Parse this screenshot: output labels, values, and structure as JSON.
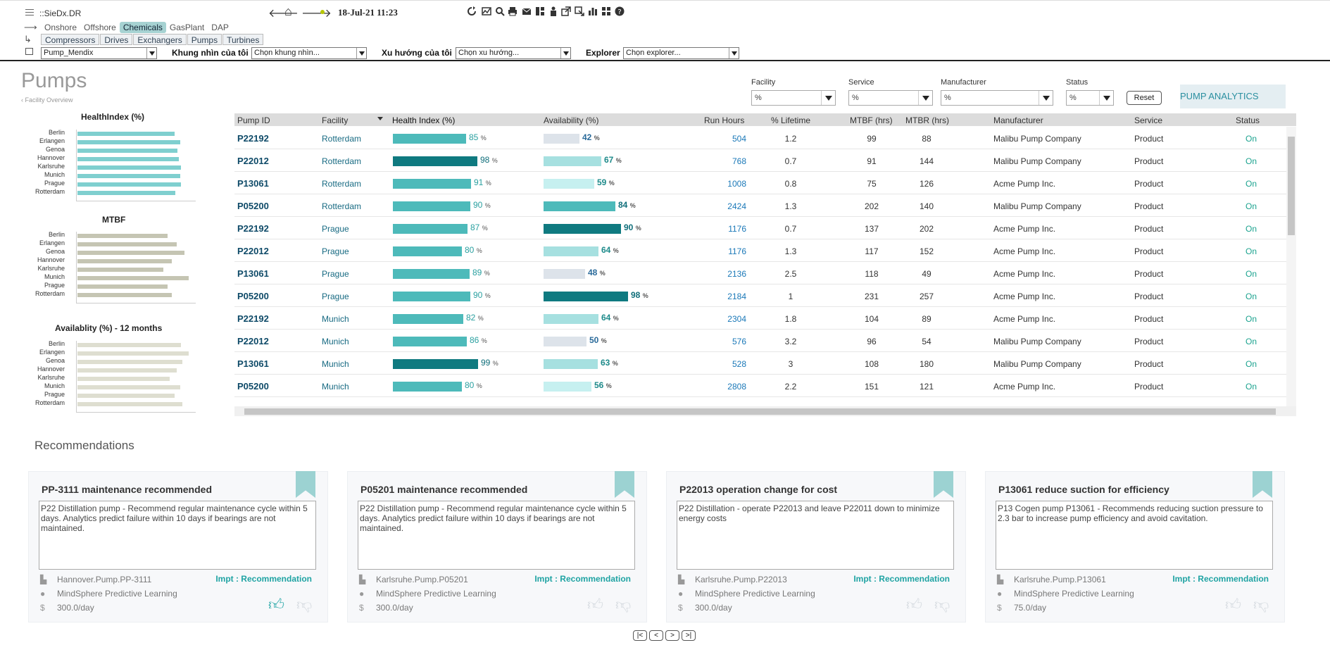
{
  "header": {
    "app_name": "::SieDx.DR",
    "datetime": "18-Jul-21 11:23",
    "nav_row1": [
      "Onshore",
      "Offshore",
      "Chemicals",
      "GasPlant",
      "DAP"
    ],
    "nav_row1_active": "Chemicals",
    "nav_row2": [
      "Compressors",
      "Drives",
      "Exchangers",
      "Pumps",
      "Turbines"
    ],
    "selectors": {
      "view_value": "Pump_Mendix",
      "khung_label": "Khung nhìn của tôi",
      "khung_value": "Chọn khung nhìn...",
      "xu_label": "Xu hướng của tôi",
      "xu_value": "Chọn xu hướng...",
      "explorer_label": "Explorer",
      "explorer_value": "Chọn explorer..."
    }
  },
  "page": {
    "title": "Pumps",
    "breadcrumb": "‹  Facility Overview",
    "analytics_label": "PUMP ANALYTICS",
    "reset_label": "Reset"
  },
  "filters": [
    {
      "label": "Facility",
      "value": "%"
    },
    {
      "label": "Service",
      "value": "%"
    },
    {
      "label": "Manufacturer",
      "value": "%"
    },
    {
      "label": "Status",
      "value": "%"
    }
  ],
  "mini_charts": {
    "cities": [
      "Berlin",
      "Erlangen",
      "Genoa",
      "Hannover",
      "Karlsruhe",
      "Munich",
      "Prague",
      "Rotterdam"
    ],
    "health": {
      "title": "HealthIndex (%)",
      "values": [
        0.86,
        0.91,
        0.89,
        0.9,
        0.92,
        0.91,
        0.92,
        0.87
      ],
      "color": "#7fcfcf"
    },
    "mtbf": {
      "title": "MTBF",
      "values": [
        0.8,
        0.88,
        0.95,
        0.84,
        0.76,
        0.99,
        0.8,
        0.84
      ],
      "color": "#c5c5b3"
    },
    "availability": {
      "title": "Availablity (%) - 12 months",
      "values": [
        0.92,
        0.99,
        0.93,
        0.88,
        0.82,
        0.91,
        0.86,
        0.93
      ],
      "color": "#deded0"
    }
  },
  "table": {
    "headers": [
      "Pump ID",
      "Facility",
      "Health Index (%)",
      "Availability (%)",
      "Run Hours",
      "% Lifetime",
      "MTBF (hrs)",
      "MTBR (hrs)",
      "Manufacturer",
      "Service",
      "Status"
    ],
    "rows": [
      {
        "id": "P22192",
        "facility": "Rotterdam",
        "health": 85,
        "avail": 42,
        "run": "504",
        "life": "1.2",
        "mtbf": "99",
        "mtbr": "88",
        "mfr": "Malibu Pump Company",
        "service": "Product",
        "status": "On"
      },
      {
        "id": "P22012",
        "facility": "Rotterdam",
        "health": 98,
        "avail": 67,
        "run": "768",
        "life": "0.7",
        "mtbf": "91",
        "mtbr": "144",
        "mfr": "Malibu Pump Company",
        "service": "Product",
        "status": "On"
      },
      {
        "id": "P13061",
        "facility": "Rotterdam",
        "health": 91,
        "avail": 59,
        "run": "1008",
        "life": "0.8",
        "mtbf": "75",
        "mtbr": "126",
        "mfr": "Acme Pump Inc.",
        "service": "Product",
        "status": "On"
      },
      {
        "id": "P05200",
        "facility": "Rotterdam",
        "health": 90,
        "avail": 84,
        "run": "2424",
        "life": "1.3",
        "mtbf": "202",
        "mtbr": "140",
        "mfr": "Malibu Pump Company",
        "service": "Product",
        "status": "On"
      },
      {
        "id": "P22192",
        "facility": "Prague",
        "health": 87,
        "avail": 90,
        "run": "1176",
        "life": "0.7",
        "mtbf": "137",
        "mtbr": "202",
        "mfr": "Acme Pump Inc.",
        "service": "Product",
        "status": "On"
      },
      {
        "id": "P22012",
        "facility": "Prague",
        "health": 80,
        "avail": 64,
        "run": "1176",
        "life": "1.3",
        "mtbf": "117",
        "mtbr": "152",
        "mfr": "Acme Pump Inc.",
        "service": "Product",
        "status": "On"
      },
      {
        "id": "P13061",
        "facility": "Prague",
        "health": 89,
        "avail": 48,
        "run": "2136",
        "life": "2.5",
        "mtbf": "118",
        "mtbr": "49",
        "mfr": "Acme Pump Inc.",
        "service": "Product",
        "status": "On"
      },
      {
        "id": "P05200",
        "facility": "Prague",
        "health": 90,
        "avail": 98,
        "run": "2184",
        "life": "1",
        "mtbf": "231",
        "mtbr": "257",
        "mfr": "Acme Pump Inc.",
        "service": "Product",
        "status": "On"
      },
      {
        "id": "P22192",
        "facility": "Munich",
        "health": 82,
        "avail": 64,
        "run": "2304",
        "life": "1.8",
        "mtbf": "104",
        "mtbr": "89",
        "mfr": "Acme Pump Inc.",
        "service": "Product",
        "status": "On"
      },
      {
        "id": "P22012",
        "facility": "Munich",
        "health": 86,
        "avail": 50,
        "run": "576",
        "life": "3.2",
        "mtbf": "96",
        "mtbr": "54",
        "mfr": "Malibu Pump Company",
        "service": "Product",
        "status": "On"
      },
      {
        "id": "P13061",
        "facility": "Munich",
        "health": 99,
        "avail": 63,
        "run": "528",
        "life": "3",
        "mtbf": "108",
        "mtbr": "180",
        "mfr": "Malibu Pump Company",
        "service": "Product",
        "status": "On"
      },
      {
        "id": "P05200",
        "facility": "Munich",
        "health": 80,
        "avail": 56,
        "run": "2808",
        "life": "2.2",
        "mtbf": "151",
        "mtbr": "121",
        "mfr": "Acme Pump Inc.",
        "service": "Product",
        "status": "On"
      }
    ]
  },
  "recommendations": {
    "title": "Recommendations",
    "cards": [
      {
        "title": "PP-3111 maintenance recommended",
        "body": "P22 Distillation pump - Recommend regular maintenance cycle within 5 days. Analytics predict failure within 10 days if bearings are not maintained.",
        "asset": "Hannover.Pump.PP-3111",
        "impt": "Impt : Recommendation",
        "source": "MindSphere Predictive Learning",
        "cost": "300.0/day",
        "liked": true
      },
      {
        "title": "P05201 maintenance recommended",
        "body": "P22 Distillation pump - Recommend regular maintenance cycle within 5 days. Analytics predict failure within 10 days if bearings are not maintained.",
        "asset": "Karlsruhe.Pump.P05201",
        "impt": "Impt : Recommendation",
        "source": "MindSphere Predictive Learning",
        "cost": "300.0/day",
        "liked": false
      },
      {
        "title": "P22013 operation change for cost",
        "body": "P22 Distillation - operate P22013 and leave P22011 down to minimize energy costs",
        "asset": "Karlsruhe.Pump.P22013",
        "impt": "Impt : Recommendation",
        "source": "MindSphere Predictive Learning",
        "cost": "300.0/day",
        "liked": false
      },
      {
        "title": "P13061 reduce suction for efficiency",
        "body": "P13 Cogen pump P13061 - Recommends reducing suction pressure to 2.3 bar to increase pump efficiency and avoid cavitation.",
        "asset": "Karlsruhe.Pump.P13061",
        "impt": "Impt : Recommendation",
        "source": "MindSphere Predictive Learning",
        "cost": "75.0/day",
        "liked": false
      }
    ]
  },
  "pager": [
    "|<",
    "<",
    ">",
    ">|"
  ],
  "colors": {
    "accent": "#1fa3a3",
    "health_bar": "#4dbaba",
    "health_bar_dark": "#0f7a80",
    "avail_light": "#a6e0e0",
    "avail_grey": "#dde3ea"
  }
}
